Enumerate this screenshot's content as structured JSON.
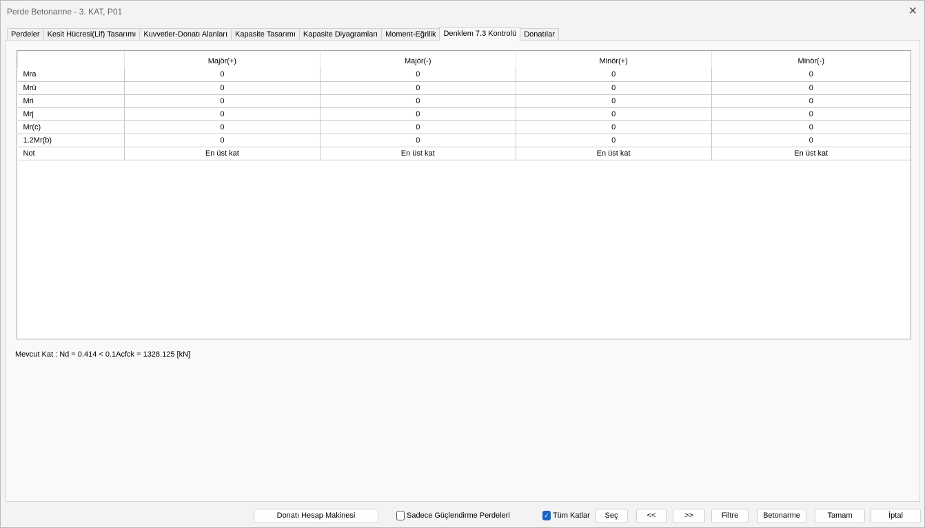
{
  "window": {
    "title": "Perde Betonarme - 3. KAT, P01",
    "close_icon": "close-icon"
  },
  "tabs": [
    "Perdeler",
    "Kesit Hücresi(Lif) Tasarımı",
    "Kuvvetler-Donatı Alanları",
    "Kapasite Tasarımı",
    "Kapasite Diyagramları",
    "Moment-Eğrilik",
    "Denklem 7.3 Kontrolü",
    "Donatılar"
  ],
  "active_tab": "Denklem 7.3 Kontrolü",
  "table": {
    "headers": [
      "",
      "Majör(+)",
      "Majör(-)",
      "Minör(+)",
      "Minör(-)"
    ],
    "rows": [
      {
        "label": "Mra",
        "values": [
          "0",
          "0",
          "0",
          "0"
        ]
      },
      {
        "label": "Mrü",
        "values": [
          "0",
          "0",
          "0",
          "0"
        ]
      },
      {
        "label": "Mri",
        "values": [
          "0",
          "0",
          "0",
          "0"
        ]
      },
      {
        "label": "Mrj",
        "values": [
          "0",
          "0",
          "0",
          "0"
        ]
      },
      {
        "label": "Mr(c)",
        "values": [
          "0",
          "0",
          "0",
          "0"
        ]
      },
      {
        "label": "1.2Mr(b)",
        "values": [
          "0",
          "0",
          "0",
          "0"
        ]
      },
      {
        "label": "Not",
        "values": [
          "En üst kat",
          "En üst kat",
          "En üst kat",
          "En üst kat"
        ]
      }
    ]
  },
  "status": "Mevcut Kat : Nd = 0.414  <  0.1Acfck = 1328.125 [kN]",
  "footer": {
    "calc_button": "Donatı Hesap Makinesi",
    "only_strengthening": {
      "label": "Sadece Güçlendirme Perdeleri",
      "checked": false
    },
    "all_floors": {
      "label": "Tüm Katlar",
      "checked": true
    },
    "select": "Seç",
    "prev": "<<",
    "next": ">>",
    "filter": "Filtre",
    "concrete": "Betonarme",
    "ok": "Tamam",
    "cancel": "İptal"
  }
}
